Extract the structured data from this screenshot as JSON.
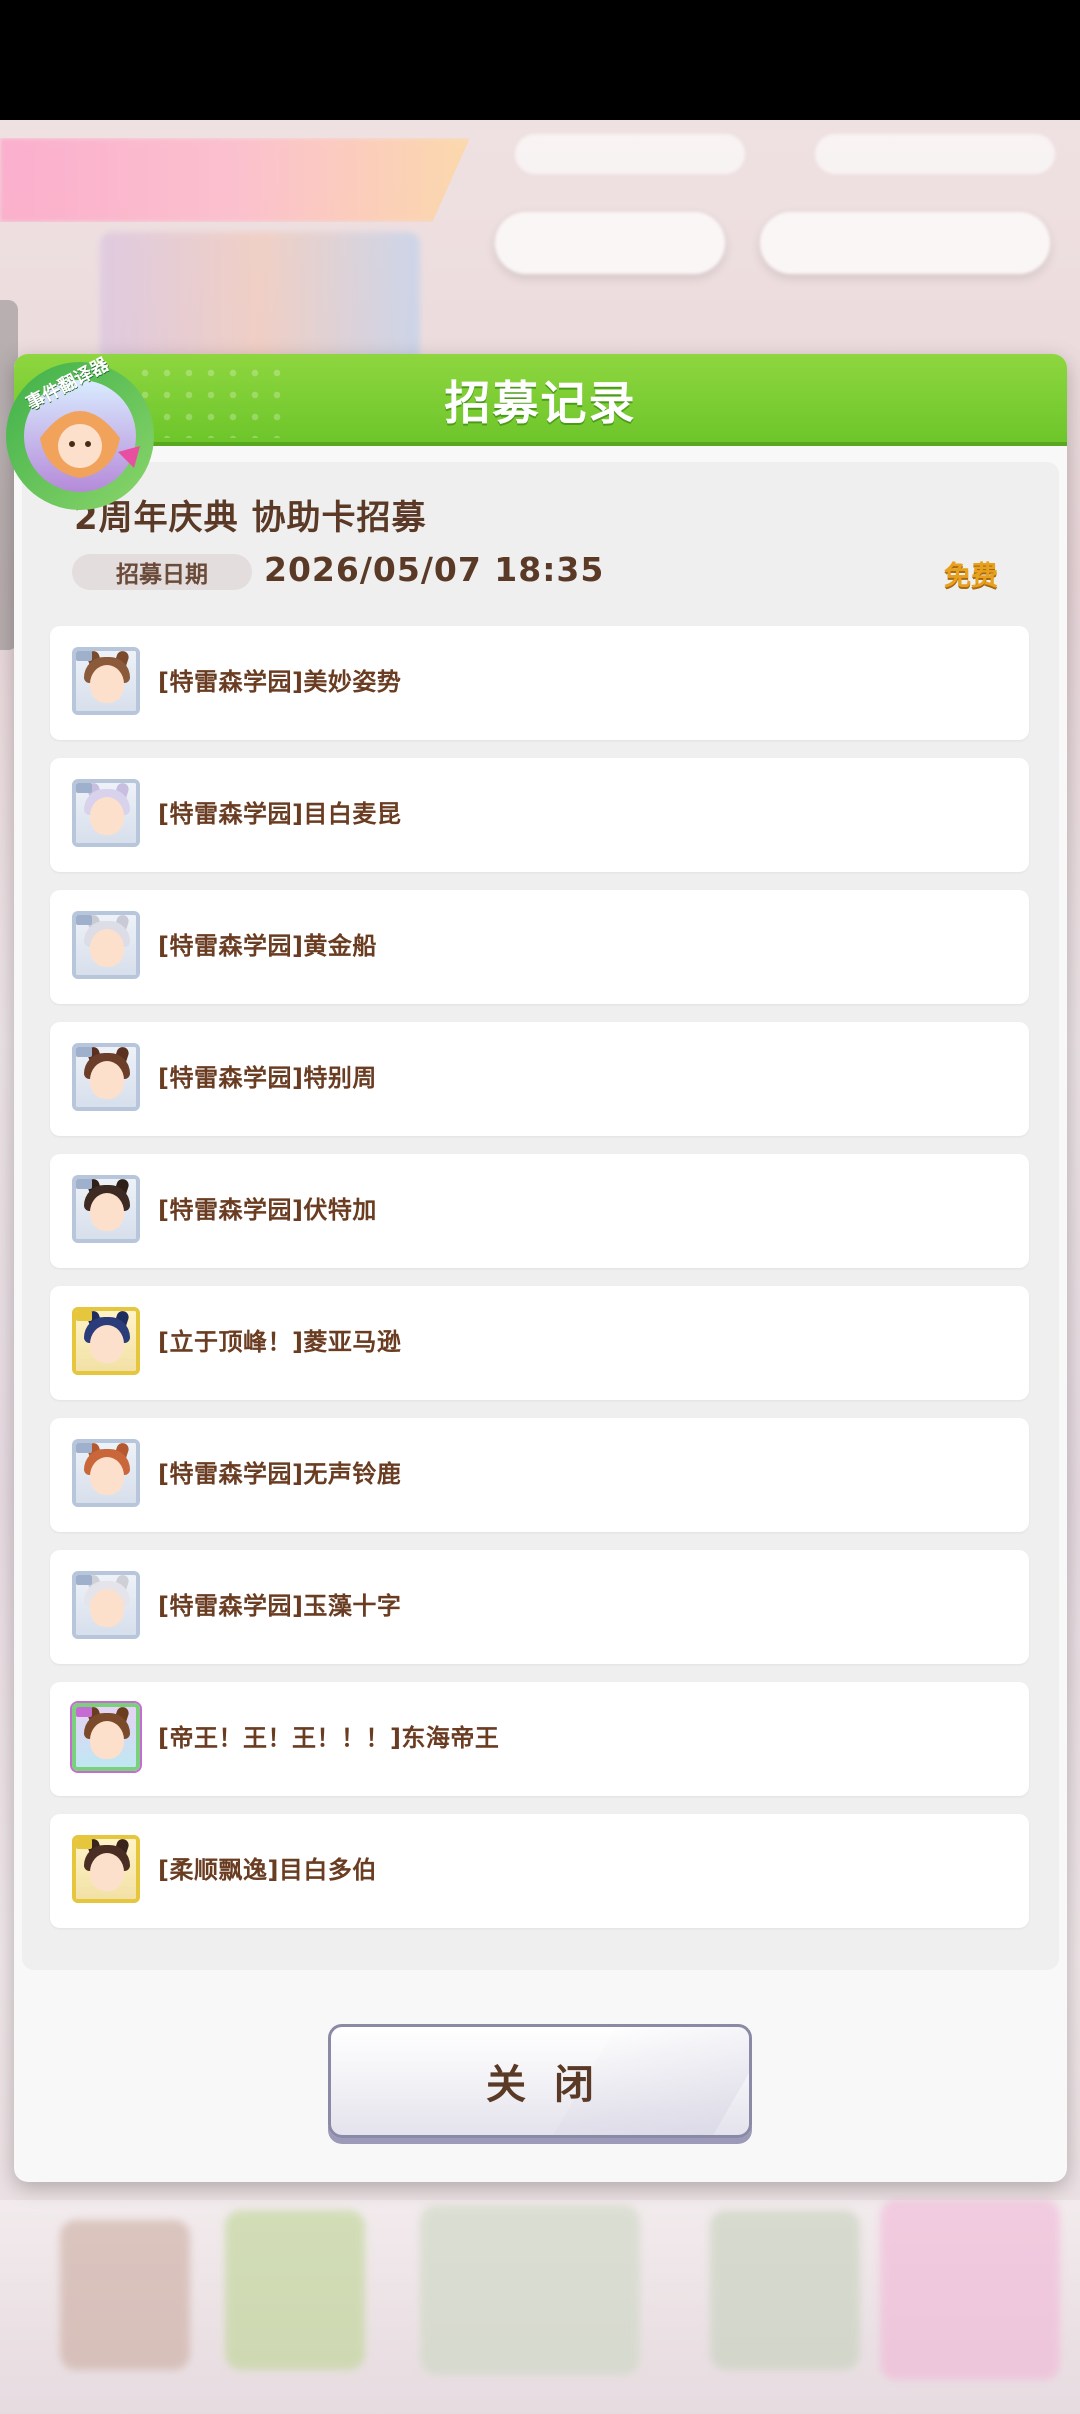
{
  "dialog": {
    "title": "招募记录",
    "event_title": "2周年庆典  协助卡招募",
    "date_label": "招募日期",
    "date_value": "2026/05/07  18:35",
    "cost_badge": "免费",
    "close_label": "关闭"
  },
  "translator_badge": {
    "label": "事件翻译器",
    "icon": "translator-app-icon"
  },
  "results": [
    {
      "name": "[特雷森学园]美妙姿势",
      "rarity": "R",
      "hair": "#8a5a3a",
      "ear": "#7a4a2e"
    },
    {
      "name": "[特雷森学园]目白麦昆",
      "rarity": "R",
      "hair": "#d9d2ec",
      "ear": "#c8bfe0"
    },
    {
      "name": "[特雷森学园]黄金船",
      "rarity": "R",
      "hair": "#dcdde6",
      "ear": "#c9cad6"
    },
    {
      "name": "[特雷森学园]特别周",
      "rarity": "R",
      "hair": "#6b3e2a",
      "ear": "#5a3020"
    },
    {
      "name": "[特雷森学园]伏特加",
      "rarity": "R",
      "hair": "#3d2a22",
      "ear": "#2e1f18"
    },
    {
      "name": "[立于顶峰！]菱亚马逊",
      "rarity": "SR",
      "hair": "#2a3c7a",
      "ear": "#1f2d5e"
    },
    {
      "name": "[特雷森学园]无声铃鹿",
      "rarity": "R",
      "hair": "#c9673a",
      "ear": "#b3582f"
    },
    {
      "name": "[特雷森学园]玉藻十字",
      "rarity": "R",
      "hair": "#e4e4ea",
      "ear": "#cfcfd8"
    },
    {
      "name": "[帝王！王！王！！！]东海帝王",
      "rarity": "SSR",
      "hair": "#7a4a2a",
      "ear": "#6a3c20"
    },
    {
      "name": "[柔顺飘逸]目白多伯",
      "rarity": "SR",
      "hair": "#4a2e24",
      "ear": "#3a231b"
    }
  ],
  "colors": {
    "header_green": "#7ccf34",
    "text_brown": "#5a3a26",
    "free_gold": "#e8a11c"
  }
}
